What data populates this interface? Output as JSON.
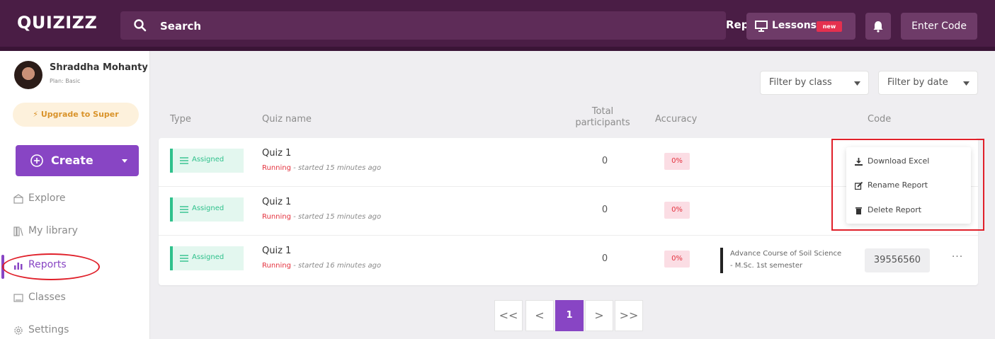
{
  "app": {
    "logo": "QUIZIZZ"
  },
  "topbar": {
    "search_placeholder": "Search",
    "section_select": "Reports",
    "lessons_label": "Lessons",
    "new_badge": "new",
    "enter_code_label": "Enter Code"
  },
  "sidebar": {
    "user_name": "Shraddha Mohanty",
    "plan": "Plan: Basic",
    "upgrade_label": "Upgrade to Super",
    "create_label": "Create",
    "items": [
      {
        "label": "Explore",
        "icon": "explore-icon"
      },
      {
        "label": "My library",
        "icon": "library-icon"
      },
      {
        "label": "Reports",
        "icon": "reports-icon"
      },
      {
        "label": "Classes",
        "icon": "classes-icon"
      },
      {
        "label": "Settings",
        "icon": "settings-icon"
      }
    ]
  },
  "filters": {
    "class_label": "Filter by class",
    "date_label": "Filter by date"
  },
  "table": {
    "headers": {
      "type": "Type",
      "quiz_name": "Quiz name",
      "participants": "Total participants",
      "accuracy": "Accuracy",
      "code": "Code"
    },
    "rows": [
      {
        "type": "Assigned",
        "name": "Quiz 1",
        "status": "Running",
        "time": " - started 15 minutes ago",
        "participants": "0",
        "accuracy": "0%",
        "class": "",
        "code": ""
      },
      {
        "type": "Assigned",
        "name": "Quiz 1",
        "status": "Running",
        "time": " - started 15 minutes ago",
        "participants": "0",
        "accuracy": "0%",
        "class": "",
        "code": ""
      },
      {
        "type": "Assigned",
        "name": "Quiz 1",
        "status": "Running",
        "time": " - started 16 minutes ago",
        "participants": "0",
        "accuracy": "0%",
        "class": "Advance Course of Soil Science - M.Sc. 1st semester",
        "code": "39556560"
      }
    ]
  },
  "menu": {
    "items": [
      {
        "label": "Download Excel",
        "icon": "download-icon"
      },
      {
        "label": "Rename Report",
        "icon": "edit-icon"
      },
      {
        "label": "Delete Report",
        "icon": "trash-icon"
      }
    ]
  },
  "pagination": {
    "first": "<<",
    "prev": "<",
    "current": "1",
    "next": ">",
    "last": ">>"
  },
  "colors": {
    "topbar": "#4a1d45",
    "accent_purple": "#8845c4",
    "assigned_green": "#2fc18c",
    "running_red": "#e4333f",
    "annotation_red": "#e0202a"
  }
}
